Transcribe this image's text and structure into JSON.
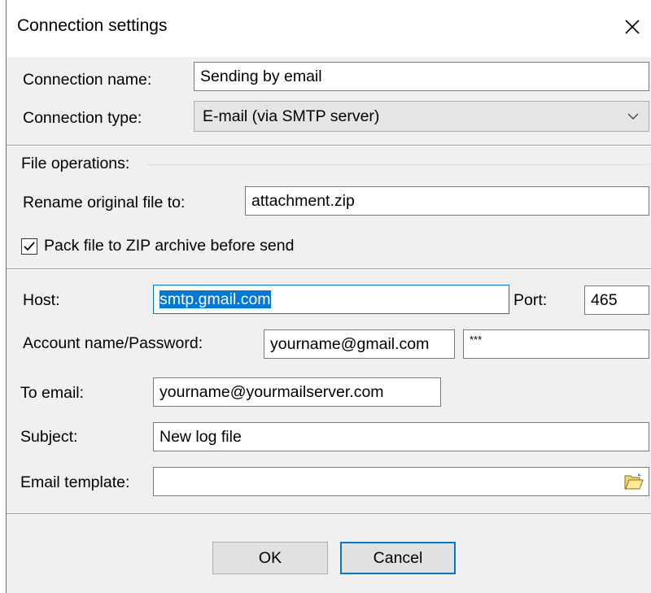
{
  "window": {
    "title": "Connection settings"
  },
  "connection": {
    "name_label": "Connection name:",
    "name_value": "Sending by email",
    "type_label": "Connection type:",
    "type_value": "E-mail (via SMTP server)"
  },
  "file_ops": {
    "group_title": "File operations:",
    "rename_label": "Rename original file to:",
    "rename_value": "attachment.zip",
    "pack_label": "Pack file to ZIP archive before send",
    "pack_checked": true
  },
  "smtp": {
    "host_label": "Host:",
    "host_value": "smtp.gmail.com",
    "port_label": "Port:",
    "port_value": "465",
    "account_label": "Account name/Password:",
    "account_value": "yourname@gmail.com",
    "password_value": "***",
    "to_label": "To email:",
    "to_value": "yourname@yourmailserver.com",
    "subject_label": "Subject:",
    "subject_value": "New log file",
    "template_label": "Email template:",
    "template_value": ""
  },
  "buttons": {
    "ok": "OK",
    "cancel": "Cancel"
  },
  "icons": {
    "close": "close-icon",
    "dropdown": "chevron-down-icon",
    "browse": "open-folder-icon",
    "check": "checkmark-icon"
  },
  "colors": {
    "accent": "#0078d7",
    "dialog_bg": "#f0f0f0",
    "selection": "#0078d7"
  }
}
